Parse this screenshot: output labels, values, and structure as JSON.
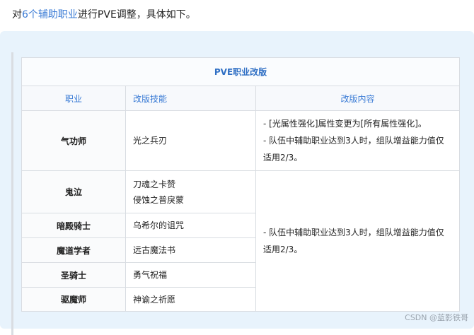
{
  "intro": {
    "prefix": "对",
    "link": "6个辅助职业",
    "suffix": "进行PVE调整，具体如下。"
  },
  "table": {
    "title": "PVE职业改版",
    "headers": [
      "职业",
      "改版技能",
      "改版内容"
    ],
    "rows": [
      {
        "job": "气功师",
        "skills": [
          "光之兵刃"
        ]
      },
      {
        "job": "鬼泣",
        "skills": [
          "刀魂之卡赞",
          "侵蚀之普戾蒙"
        ]
      },
      {
        "job": "暗殿骑士",
        "skills": [
          "乌希尔的诅咒"
        ]
      },
      {
        "job": "魔道学者",
        "skills": [
          "远古魔法书"
        ]
      },
      {
        "job": "圣骑士",
        "skills": [
          "勇气祝福"
        ]
      },
      {
        "job": "驱魔师",
        "skills": [
          "神谕之祈愿"
        ]
      }
    ],
    "content_1": [
      "- [光属性强化]属性变更为[所有属性强化]。",
      "- 队伍中辅助职业达到3人时，组队增益能力值仅适用2/3。"
    ],
    "content_2": [
      "- 队伍中辅助职业达到3人时，组队增益能力值仅适用2/3。"
    ]
  },
  "watermark": "CSDN @蓝影铁哥"
}
